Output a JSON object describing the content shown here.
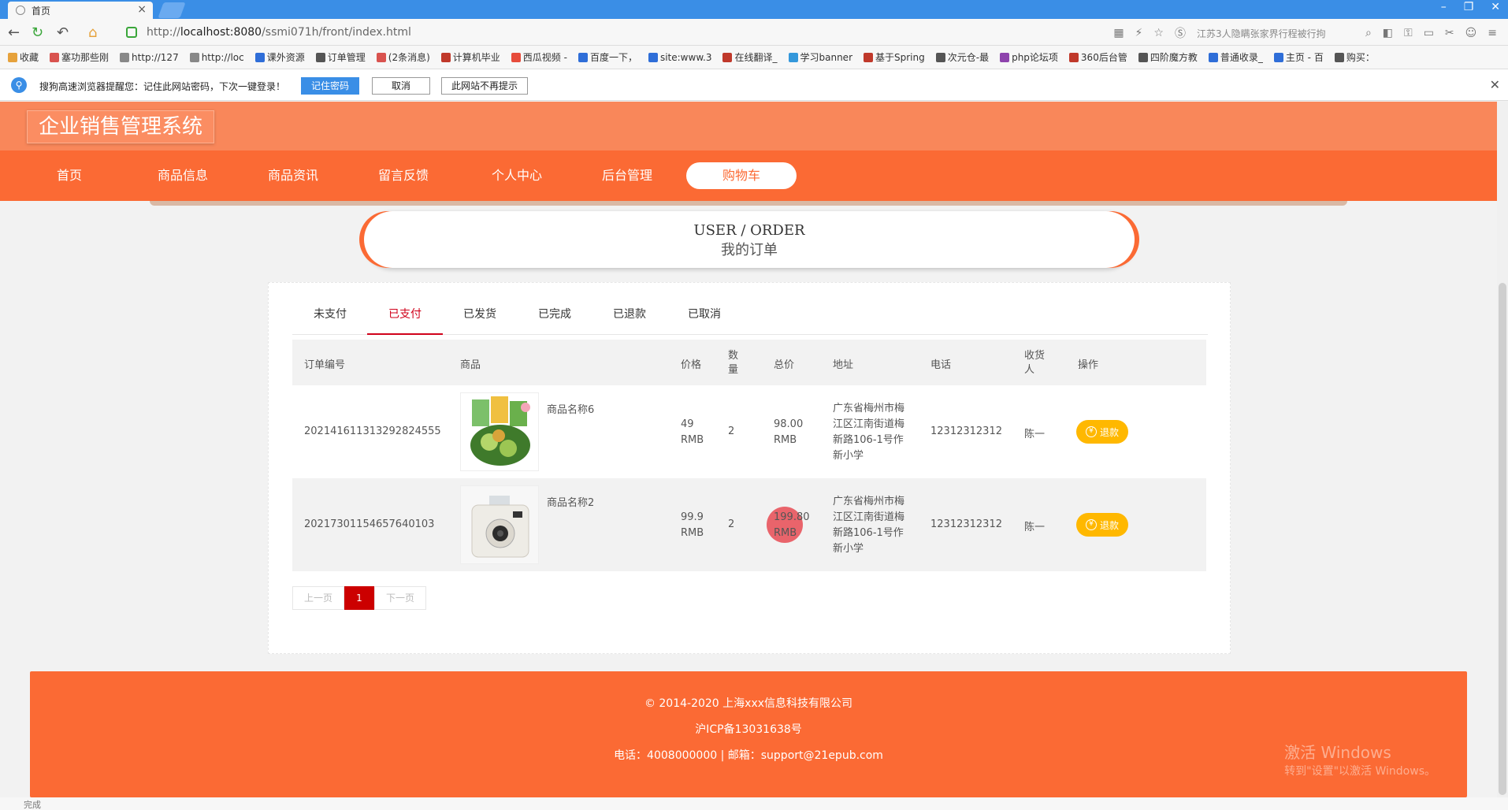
{
  "browser": {
    "tab_title": "首页",
    "url_prefix": "http://",
    "url_host": "localhost:8080",
    "url_path": "/ssmi071h/front/index.html",
    "search_placeholder": "江苏3人隐瞒张家界行程被行拘"
  },
  "bookmarks": [
    "收藏",
    "塞功那些刚",
    "http://127",
    "http://loc",
    "课外资源",
    "订单管理",
    "(2条消息)",
    "计算机毕业",
    "西瓜视频 -",
    "百度一下，",
    "site:www.3",
    "在线翻译_",
    "学习banner",
    "基于Spring",
    "次元仓-最",
    "php论坛项",
    "360后台管",
    "四阶魔方教",
    "普通收录_",
    "主页 - 百",
    "购买："
  ],
  "password_bar": {
    "text": "搜狗高速浏览器提醒您：记住此网站密码，下次一键登录！",
    "remember": "记住密码",
    "cancel": "取消",
    "never": "此网站不再提示"
  },
  "site": {
    "logo": "企业销售管理系统",
    "nav": [
      "首页",
      "商品信息",
      "商品资讯",
      "留言反馈",
      "个人中心",
      "后台管理",
      "购物车"
    ],
    "active_nav_index": 6,
    "title_en": "USER / ORDER",
    "title_cn": "我的订单"
  },
  "order_tabs": [
    "未支付",
    "已支付",
    "已发货",
    "已完成",
    "已退款",
    "已取消"
  ],
  "active_tab_index": 1,
  "table": {
    "headers": {
      "order_no": "订单编号",
      "product": "商品",
      "price": "价格",
      "qty": "数量",
      "total": "总价",
      "address": "地址",
      "phone": "电话",
      "receiver": "收货人",
      "action": "操作"
    },
    "rows": [
      {
        "order_no": "20214161131329282455​5",
        "product_name": "商品名称6",
        "product_image": "green-zongzi-snack-icon",
        "price": "49 RMB",
        "qty": "2",
        "total": "98.00 RMB",
        "address": "广东省梅州市梅江区江南街道梅新路106-1号作新小学",
        "phone": "12312312312",
        "receiver": "陈一",
        "action": "退款"
      },
      {
        "order_no": "20217301154657640103",
        "product_name": "商品名称2",
        "product_image": "instant-camera-icon",
        "price": "99.9 RMB",
        "qty": "2",
        "total": "199.80 RMB",
        "address": "广东省梅州市梅江区江南街道梅新路106-1号作新小学",
        "phone": "12312312312",
        "receiver": "陈一",
        "action": "退款"
      }
    ]
  },
  "pager": {
    "prev": "上一页",
    "current": "1",
    "next": "下一页"
  },
  "footer": {
    "copyright": "© 2014-2020 上海xxx信息科技有限公司",
    "icp": "沪ICP备13031638号",
    "contact": "电话：4008000000 | 邮箱：support@21epub.com",
    "watermark_1": "激活 Windows",
    "watermark_2": "转到\"设置\"以激活 Windows。"
  },
  "statusbar": {
    "left": "完成"
  },
  "colors": {
    "accent": "#fb6a34",
    "header": "#f9875a",
    "refund": "#ffb800",
    "active_tab": "#d0021b"
  }
}
